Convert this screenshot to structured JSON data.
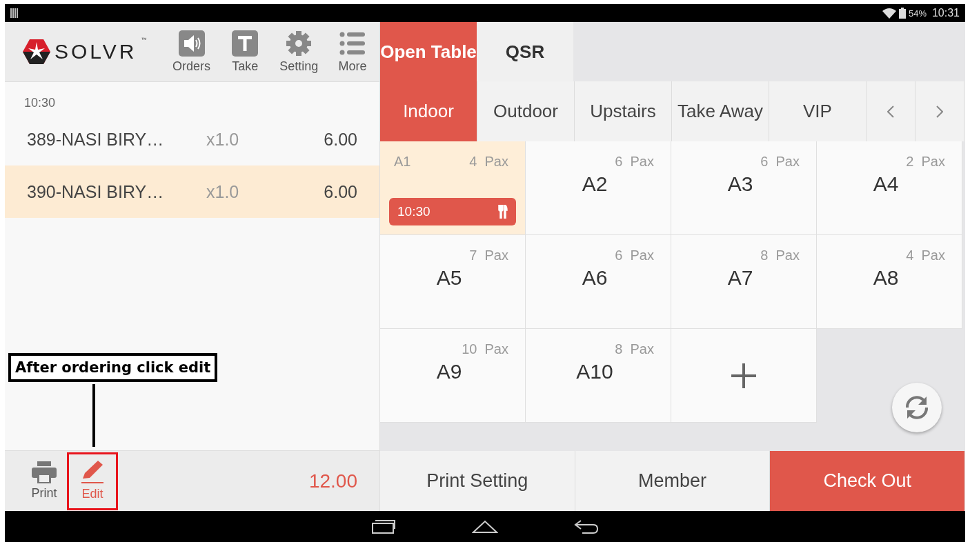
{
  "status_bar": {
    "battery": "54%",
    "time": "10:31"
  },
  "header": {
    "logo": "SOLVR",
    "logo_mark": "™",
    "actions": [
      {
        "kind": "orders",
        "label": "Orders"
      },
      {
        "kind": "take",
        "label": "Take"
      },
      {
        "kind": "setting",
        "label": "Setting"
      },
      {
        "kind": "more",
        "label": "More"
      }
    ]
  },
  "mode_tabs": [
    {
      "label": "Open Table",
      "selected": true
    },
    {
      "label": "QSR",
      "selected": false
    }
  ],
  "order": {
    "time": "10:30",
    "items": [
      {
        "name": "389-NASI BIRY…",
        "qty": "x1.0",
        "price": "6.00",
        "selected": false
      },
      {
        "name": "390-NASI BIRY…",
        "qty": "x1.0",
        "price": "6.00",
        "selected": true
      }
    ],
    "actions": [
      {
        "kind": "print",
        "label": "Print"
      },
      {
        "kind": "edit",
        "label": "Edit",
        "highlighted": true
      }
    ],
    "total": "12.00"
  },
  "floor_tabs": [
    {
      "label": "Indoor",
      "selected": true
    },
    {
      "label": "Outdoor",
      "selected": false
    },
    {
      "label": "Upstairs",
      "selected": false
    },
    {
      "label": "Take Away",
      "selected": false
    },
    {
      "label": "VIP",
      "selected": false
    }
  ],
  "tables": [
    {
      "kind": "occupied",
      "name": "A1",
      "pax": "4  Pax",
      "time": "10:30"
    },
    {
      "kind": "free",
      "name": "A2",
      "pax": "6  Pax"
    },
    {
      "kind": "free",
      "name": "A3",
      "pax": "6  Pax"
    },
    {
      "kind": "free",
      "name": "A4",
      "pax": "2  Pax"
    },
    {
      "kind": "free",
      "name": "A5",
      "pax": "7  Pax"
    },
    {
      "kind": "free",
      "name": "A6",
      "pax": "6  Pax"
    },
    {
      "kind": "free",
      "name": "A7",
      "pax": "8  Pax"
    },
    {
      "kind": "free",
      "name": "A8",
      "pax": "4  Pax"
    },
    {
      "kind": "free",
      "name": "A9",
      "pax": "10  Pax"
    },
    {
      "kind": "free",
      "name": "A10",
      "pax": "8  Pax"
    },
    {
      "kind": "add"
    }
  ],
  "bottom_buttons": [
    {
      "kind": "plain",
      "label": "Print Setting"
    },
    {
      "kind": "plain",
      "label": "Member"
    },
    {
      "kind": "primary",
      "label": "Check Out"
    }
  ],
  "annotation": {
    "text": "After ordering click edit"
  }
}
